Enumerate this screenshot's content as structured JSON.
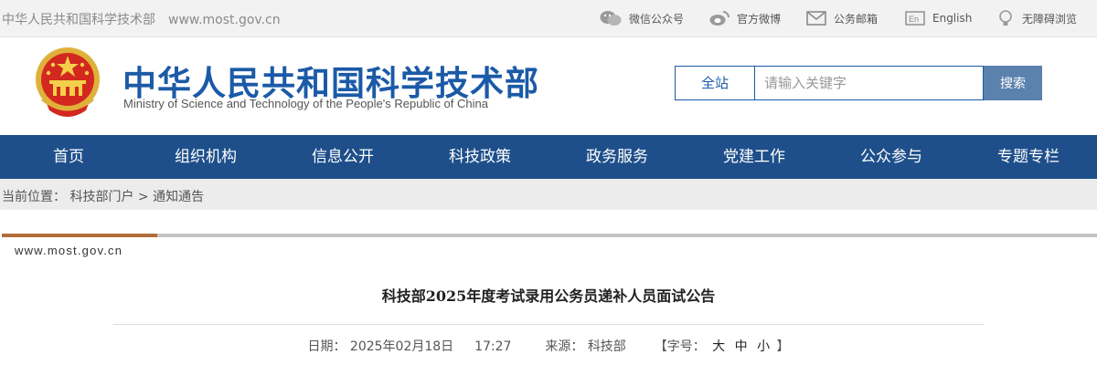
{
  "topbar": {
    "site_name": "中华人民共和国科学技术部",
    "site_url": "www.most.gov.cn",
    "links": [
      {
        "icon": "wechat-icon",
        "label": "微信公众号"
      },
      {
        "icon": "weibo-icon",
        "label": "官方微博"
      },
      {
        "icon": "mail-icon",
        "label": "公务邮箱"
      },
      {
        "icon": "english-icon",
        "label": "English"
      },
      {
        "icon": "accessibility-icon",
        "label": "无障碍浏览"
      }
    ]
  },
  "header": {
    "emblem_icon": "national-emblem-icon",
    "title_cn": "中华人民共和国科学技术部",
    "title_en": "Ministry of Science and Technology of the People's Republic of China"
  },
  "search": {
    "scope": "全站",
    "placeholder": "请输入关键字",
    "value": "",
    "button": "搜索"
  },
  "nav": {
    "items": [
      "首页",
      "组织机构",
      "信息公开",
      "科技政策",
      "政务服务",
      "党建工作",
      "公众参与",
      "专题专栏"
    ]
  },
  "breadcrumb": {
    "prefix": "当前位置：",
    "home": "科技部门户",
    "separator": ">",
    "current": "通知通告"
  },
  "article": {
    "watermark": "www.most.gov.cn",
    "title": "科技部2025年度考试录用公务员递补人员面试公告",
    "date_label": "日期：",
    "date": "2025年02月18日",
    "time": "17:27",
    "source_label": "来源：",
    "source": "科技部",
    "fontsize_label": "【字号：",
    "fontsize_options": [
      "大",
      "中",
      "小"
    ],
    "fontsize_close": "】"
  },
  "colors": {
    "brand_blue": "#1b5aa7",
    "nav_blue": "#1e4f8a",
    "search_button": "#5b81ad",
    "accent_brown": "#b06d3a"
  }
}
